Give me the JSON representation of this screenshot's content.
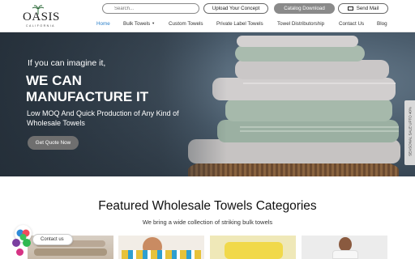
{
  "logo": {
    "word": "OASIS",
    "sub": "CALIFORNIA"
  },
  "header": {
    "search_placeholder": "Search...",
    "upload_label": "Upload Your Concept",
    "catalog_label": "Catalog Download",
    "mail_label": "Send Mail"
  },
  "nav": {
    "items": [
      {
        "label": "Home"
      },
      {
        "label": "Bulk Towels"
      },
      {
        "label": "Custom Towels"
      },
      {
        "label": "Private Label Towels"
      },
      {
        "label": "Towel Distributorship"
      },
      {
        "label": "Contact Us"
      },
      {
        "label": "Blog"
      }
    ],
    "active": "Home"
  },
  "hero": {
    "tagline": "If you can imagine it,",
    "title_line1": "WE CAN",
    "title_line2": "MANUFACTURE IT",
    "subtitle_line1": "Low MOQ And Quick Production of Any Kind of",
    "subtitle_line2": "Wholesale Towels",
    "cta": "Get Quote Now"
  },
  "side_tab": {
    "label": "SEASONAL SALE UPTO 40%"
  },
  "featured": {
    "title": "Featured Wholesale Towels Categories",
    "subtitle": "We bring a wide collection of striking bulk towels"
  },
  "contact_widget": {
    "label": "Contact us"
  },
  "colors": {
    "accent_blue": "#2a7fc9",
    "catalog_button": "#8a8a8a",
    "cta_button": "#6f6f6f",
    "towel_gray": "#c9c6c6",
    "towel_sage": "#9fb2a4"
  }
}
